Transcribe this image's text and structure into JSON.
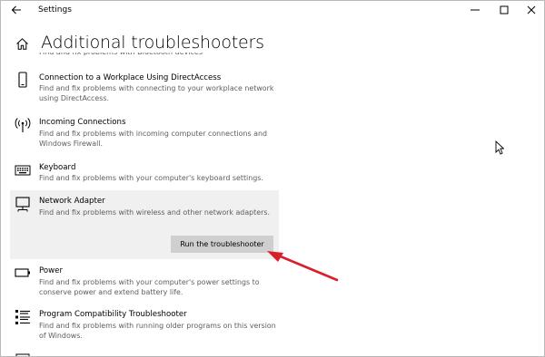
{
  "window": {
    "title": "Settings",
    "minimize_icon": "minimize-icon",
    "maximize_icon": "maximize-icon",
    "close_icon": "close-icon"
  },
  "page": {
    "title": "Additional troubleshooters",
    "cut_text": "Find and fix problems with Bluetooth devices"
  },
  "items": [
    {
      "name": "Connection to a Workplace Using DirectAccess",
      "desc": "Find and fix problems with connecting to your workplace network using DirectAccess.",
      "icon": "phone-icon"
    },
    {
      "name": "Incoming Connections",
      "desc": "Find and fix problems with incoming computer connections and Windows Firewall.",
      "icon": "antenna-icon"
    },
    {
      "name": "Keyboard",
      "desc": "Find and fix problems with your computer's keyboard settings.",
      "icon": "keyboard-icon"
    },
    {
      "name": "Network Adapter",
      "desc": "Find and fix problems with wireless and other network adapters.",
      "icon": "network-monitor-icon",
      "button": "Run the troubleshooter"
    },
    {
      "name": "Power",
      "desc": "Find and fix problems with your computer's power settings to conserve power and extend battery life.",
      "icon": "battery-icon"
    },
    {
      "name": "Program Compatibility Troubleshooter",
      "desc": "Find and fix problems with running older programs on this version of Windows.",
      "icon": "list-icon"
    }
  ],
  "colors": {
    "annotation_arrow": "#d9202a",
    "selected_background": "#f0f0f0",
    "button_background": "#cfcfcf"
  }
}
